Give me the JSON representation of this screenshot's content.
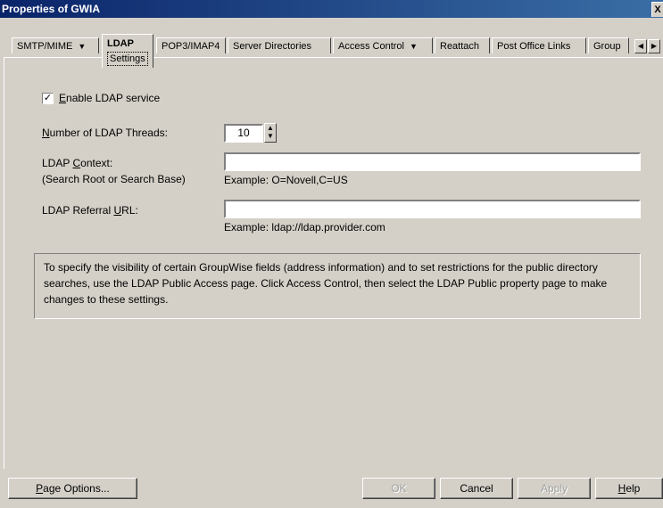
{
  "window": {
    "title": "Properties of GWIA",
    "close_glyph": "X"
  },
  "tabs": [
    {
      "label": "SMTP/MIME",
      "has_menu": true
    },
    {
      "label": "LDAP",
      "sublabel": "Settings",
      "active": true
    },
    {
      "label": "POP3/IMAP4"
    },
    {
      "label": "Server Directories"
    },
    {
      "label": "Access Control",
      "has_menu": true
    },
    {
      "label": "Reattach"
    },
    {
      "label": "Post Office Links"
    },
    {
      "label": "Group"
    }
  ],
  "tab_scroll": {
    "left": "◀",
    "right": "▶"
  },
  "form": {
    "enable_ldap": {
      "label_pre": "",
      "label_key": "E",
      "label_rest": "nable LDAP service",
      "checked": true,
      "check_glyph": "✓"
    },
    "threads": {
      "label_key": "N",
      "label_rest": "umber of LDAP Threads:",
      "value": "10",
      "spin_up": "▲",
      "spin_down": "▼"
    },
    "context": {
      "label_pre": "LDAP ",
      "label_key": "C",
      "label_rest": "ontext:",
      "label_line2": "(Search Root or Search Base)",
      "value": "",
      "example": "Example: O=Novell,C=US"
    },
    "referral": {
      "label_pre": "LDAP Referral ",
      "label_key": "U",
      "label_rest": "RL:",
      "value": "",
      "example": "Example: ldap://ldap.provider.com"
    }
  },
  "info": "To specify the visibility of certain GroupWise fields (address information) and to set restrictions for the public directory searches, use the LDAP Public Access page. Click Access Control, then select the LDAP Public property page to make changes to these settings.",
  "buttons": {
    "page_options": {
      "key": "P",
      "rest": "age Options..."
    },
    "ok": "OK",
    "cancel": "Cancel",
    "apply": "Apply",
    "help": {
      "key": "H",
      "rest": "elp"
    }
  }
}
